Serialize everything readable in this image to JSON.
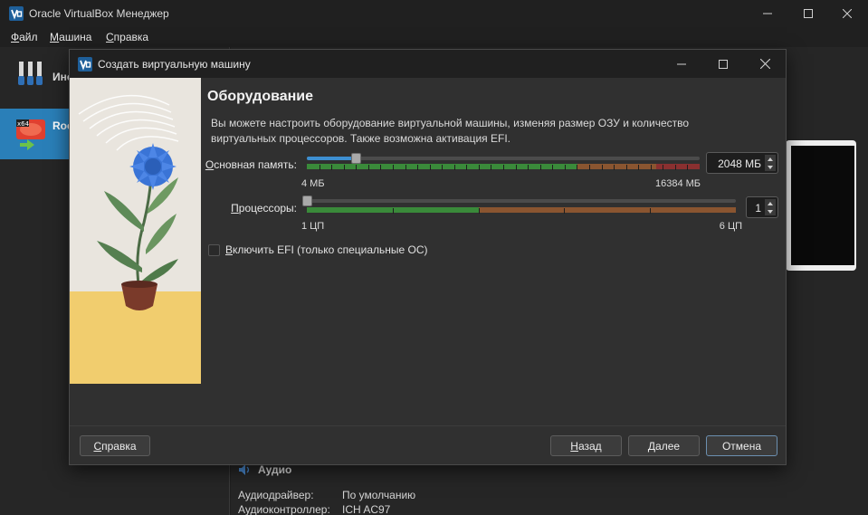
{
  "app": {
    "title": "Oracle VirtualBox Менеджер",
    "menu": [
      {
        "label": "Файл",
        "mnemonic": "Ф",
        "rest": "айл"
      },
      {
        "label": "Машина",
        "mnemonic": "М",
        "rest": "ашина"
      },
      {
        "label": "Справка",
        "mnemonic": "С",
        "rest": "правка"
      }
    ]
  },
  "sidebar": {
    "tools_label": "Инс",
    "vm_label": "Roc",
    "vm_badge": "x64"
  },
  "details": {
    "audio_heading": "Аудио",
    "rows": [
      {
        "key": "Аудиодрайвер:",
        "value": "По умолчанию"
      },
      {
        "key": "Аудиоконтроллер:",
        "value": "ICH AC97"
      }
    ]
  },
  "dialog": {
    "title": "Создать виртуальную машину",
    "heading": "Оборудование",
    "description": "Вы можете настроить оборудование виртуальной машины, изменяя размер ОЗУ и количество виртуальных процессоров. Также возможна активация EFI.",
    "memory": {
      "label_mnemonic": "О",
      "label_rest": "сновная память:",
      "value": "2048 МБ",
      "min_label": "4 МБ",
      "max_label": "16384 МБ",
      "fraction": 0.125
    },
    "cpu": {
      "label_mnemonic": "П",
      "label_rest": "роцессоры:",
      "value": "1",
      "min_label": "1 ЦП",
      "max_label": "6 ЦП",
      "fraction": 0.0
    },
    "efi": {
      "label_mnemonic": "В",
      "label_rest": "ключить EFI (только специальные ОС)",
      "checked": false
    },
    "buttons": {
      "help": {
        "mnemonic": "С",
        "rest": "правка"
      },
      "back": {
        "mnemonic": "Н",
        "rest": "азад"
      },
      "next": {
        "mnemonic": "Д",
        "rest": "алее"
      },
      "cancel": "Отмена"
    }
  },
  "colors": {
    "accent": "#2a7fb8",
    "scale_green": "#3a8a3a",
    "scale_orange": "#8a5530",
    "scale_red": "#8a3030"
  }
}
